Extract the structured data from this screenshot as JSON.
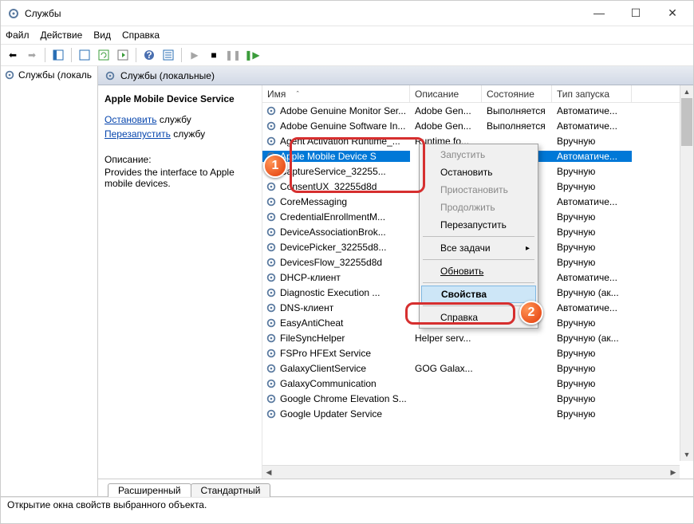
{
  "window": {
    "title": "Службы"
  },
  "menu": {
    "file": "Файл",
    "action": "Действие",
    "view": "Вид",
    "help": "Справка"
  },
  "left": {
    "item": "Службы (локаль"
  },
  "panel_header": "Службы (локальные)",
  "detail": {
    "title": "Apple Mobile Device Service",
    "stop_a": "Остановить",
    "stop_b": "службу",
    "restart_a": "Перезапустить",
    "restart_b": "службу",
    "desc_label": "Описание:",
    "desc": "Provides the interface to Apple mobile devices."
  },
  "columns": {
    "name": "Имя",
    "desc": "Описание",
    "state": "Состояние",
    "startup": "Тип запуска"
  },
  "rows": [
    {
      "n": "Adobe Genuine Monitor Ser...",
      "d": "Adobe Gen...",
      "s": "Выполняется",
      "t": "Автоматиче..."
    },
    {
      "n": "Adobe Genuine Software In...",
      "d": "Adobe Gen...",
      "s": "Выполняется",
      "t": "Автоматиче..."
    },
    {
      "n": "Agent Activation Runtime_...",
      "d": "Runtime fo...",
      "s": "",
      "t": "Вручную"
    },
    {
      "n": "Apple Mobile Device S",
      "d": "",
      "s": "яется",
      "t": "Автоматиче...",
      "sel": true
    },
    {
      "n": "CaptureService_32255...",
      "d": "",
      "s": "",
      "t": "Вручную"
    },
    {
      "n": "ConsentUX_32255d8d",
      "d": "",
      "s": "",
      "t": "Вручную"
    },
    {
      "n": "CoreMessaging",
      "d": "",
      "s": "яется",
      "t": "Автоматиче..."
    },
    {
      "n": "CredentialEnrollmentM...",
      "d": "",
      "s": "",
      "t": "Вручную"
    },
    {
      "n": "DeviceAssociationBrok...",
      "d": "",
      "s": "",
      "t": "Вручную"
    },
    {
      "n": "DevicePicker_32255d8...",
      "d": "",
      "s": "",
      "t": "Вручную"
    },
    {
      "n": "DevicesFlow_32255d8d",
      "d": "",
      "s": "",
      "t": "Вручную"
    },
    {
      "n": "DHCP-клиент",
      "d": "",
      "s": "яется",
      "t": "Автоматиче..."
    },
    {
      "n": "Diagnostic Execution ...",
      "d": "",
      "s": "",
      "t": "Вручную (ак..."
    },
    {
      "n": "DNS-клиент",
      "d": "",
      "s": "...я",
      "t": "Автоматиче..."
    },
    {
      "n": "EasyAntiCheat",
      "d": "",
      "s": "",
      "t": "Вручную"
    },
    {
      "n": "FileSyncHelper",
      "d": "Helper serv...",
      "s": "",
      "t": "Вручную (ак..."
    },
    {
      "n": "FSPro HFExt Service",
      "d": "",
      "s": "",
      "t": "Вручную"
    },
    {
      "n": "GalaxyClientService",
      "d": "GOG Galax...",
      "s": "",
      "t": "Вручную"
    },
    {
      "n": "GalaxyCommunication",
      "d": "",
      "s": "",
      "t": "Вручную"
    },
    {
      "n": "Google Chrome Elevation S...",
      "d": "",
      "s": "",
      "t": "Вручную"
    },
    {
      "n": "Google Updater Service",
      "d": "",
      "s": "",
      "t": "Вручную"
    }
  ],
  "context": {
    "start": "Запустить",
    "stop": "Остановить",
    "pause": "Приостановить",
    "resume": "Продолжить",
    "restart": "Перезапустить",
    "alltasks": "Все задачи",
    "refresh": "Обновить",
    "properties": "Свойства",
    "help": "Справка"
  },
  "tabs": {
    "ext": "Расширенный",
    "std": "Стандартный"
  },
  "status": "Открытие окна свойств выбранного объекта.",
  "badges": {
    "b1": "1",
    "b2": "2"
  }
}
